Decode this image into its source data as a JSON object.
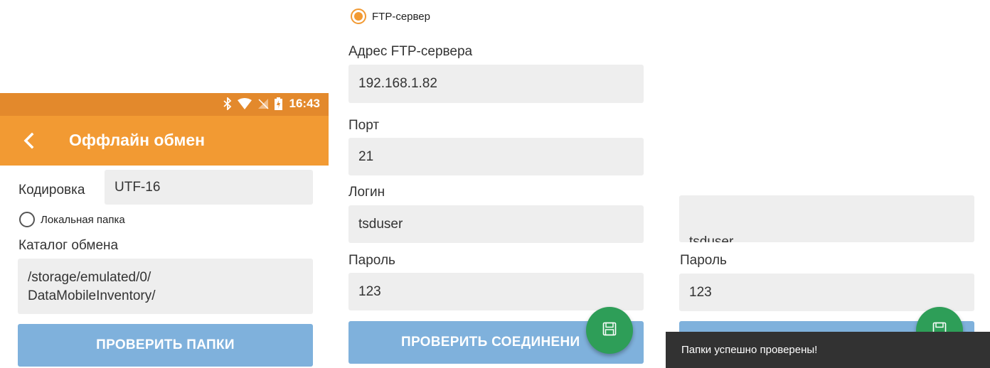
{
  "screen1": {
    "status_time": "16:43",
    "title": "Оффлайн обмен",
    "encoding_label": "Кодировка",
    "encoding_value": "UTF-16",
    "local_folder_label": "Локальная папка",
    "catalog_label": "Каталог обмена",
    "catalog_line1": "/storage/emulated/0/",
    "catalog_line2": "DataMobileInventory/",
    "check_folders_button": "ПРОВЕРИТЬ ПАПКИ"
  },
  "screen2": {
    "ftp_server_label": "FTP-сервер",
    "ftp_address_label": "Адрес FTP-сервера",
    "ftp_address_value": "192.168.1.82",
    "port_label": "Порт",
    "port_value": "21",
    "login_label": "Логин",
    "login_value": "tsduser",
    "password_label": "Пароль",
    "password_value": "123",
    "check_connection_button": "ПРОВЕРИТЬ СОЕДИНЕНИ"
  },
  "screen3": {
    "login_value_partial": "tsduser",
    "password_label": "Пароль",
    "password_value": "123",
    "snackbar_text": "Папки успешно проверены!"
  },
  "colors": {
    "status_bar": "#e3892c",
    "app_bar": "#f29a33",
    "button": "#7fb1dc",
    "fab": "#2e9e58",
    "snackbar": "#323232"
  },
  "icons": {
    "back": "chevron-left-icon",
    "bluetooth": "bluetooth-icon",
    "wifi": "wifi-icon",
    "signal": "no-signal-icon",
    "battery": "battery-charging-icon",
    "save": "floppy-disk-icon"
  }
}
